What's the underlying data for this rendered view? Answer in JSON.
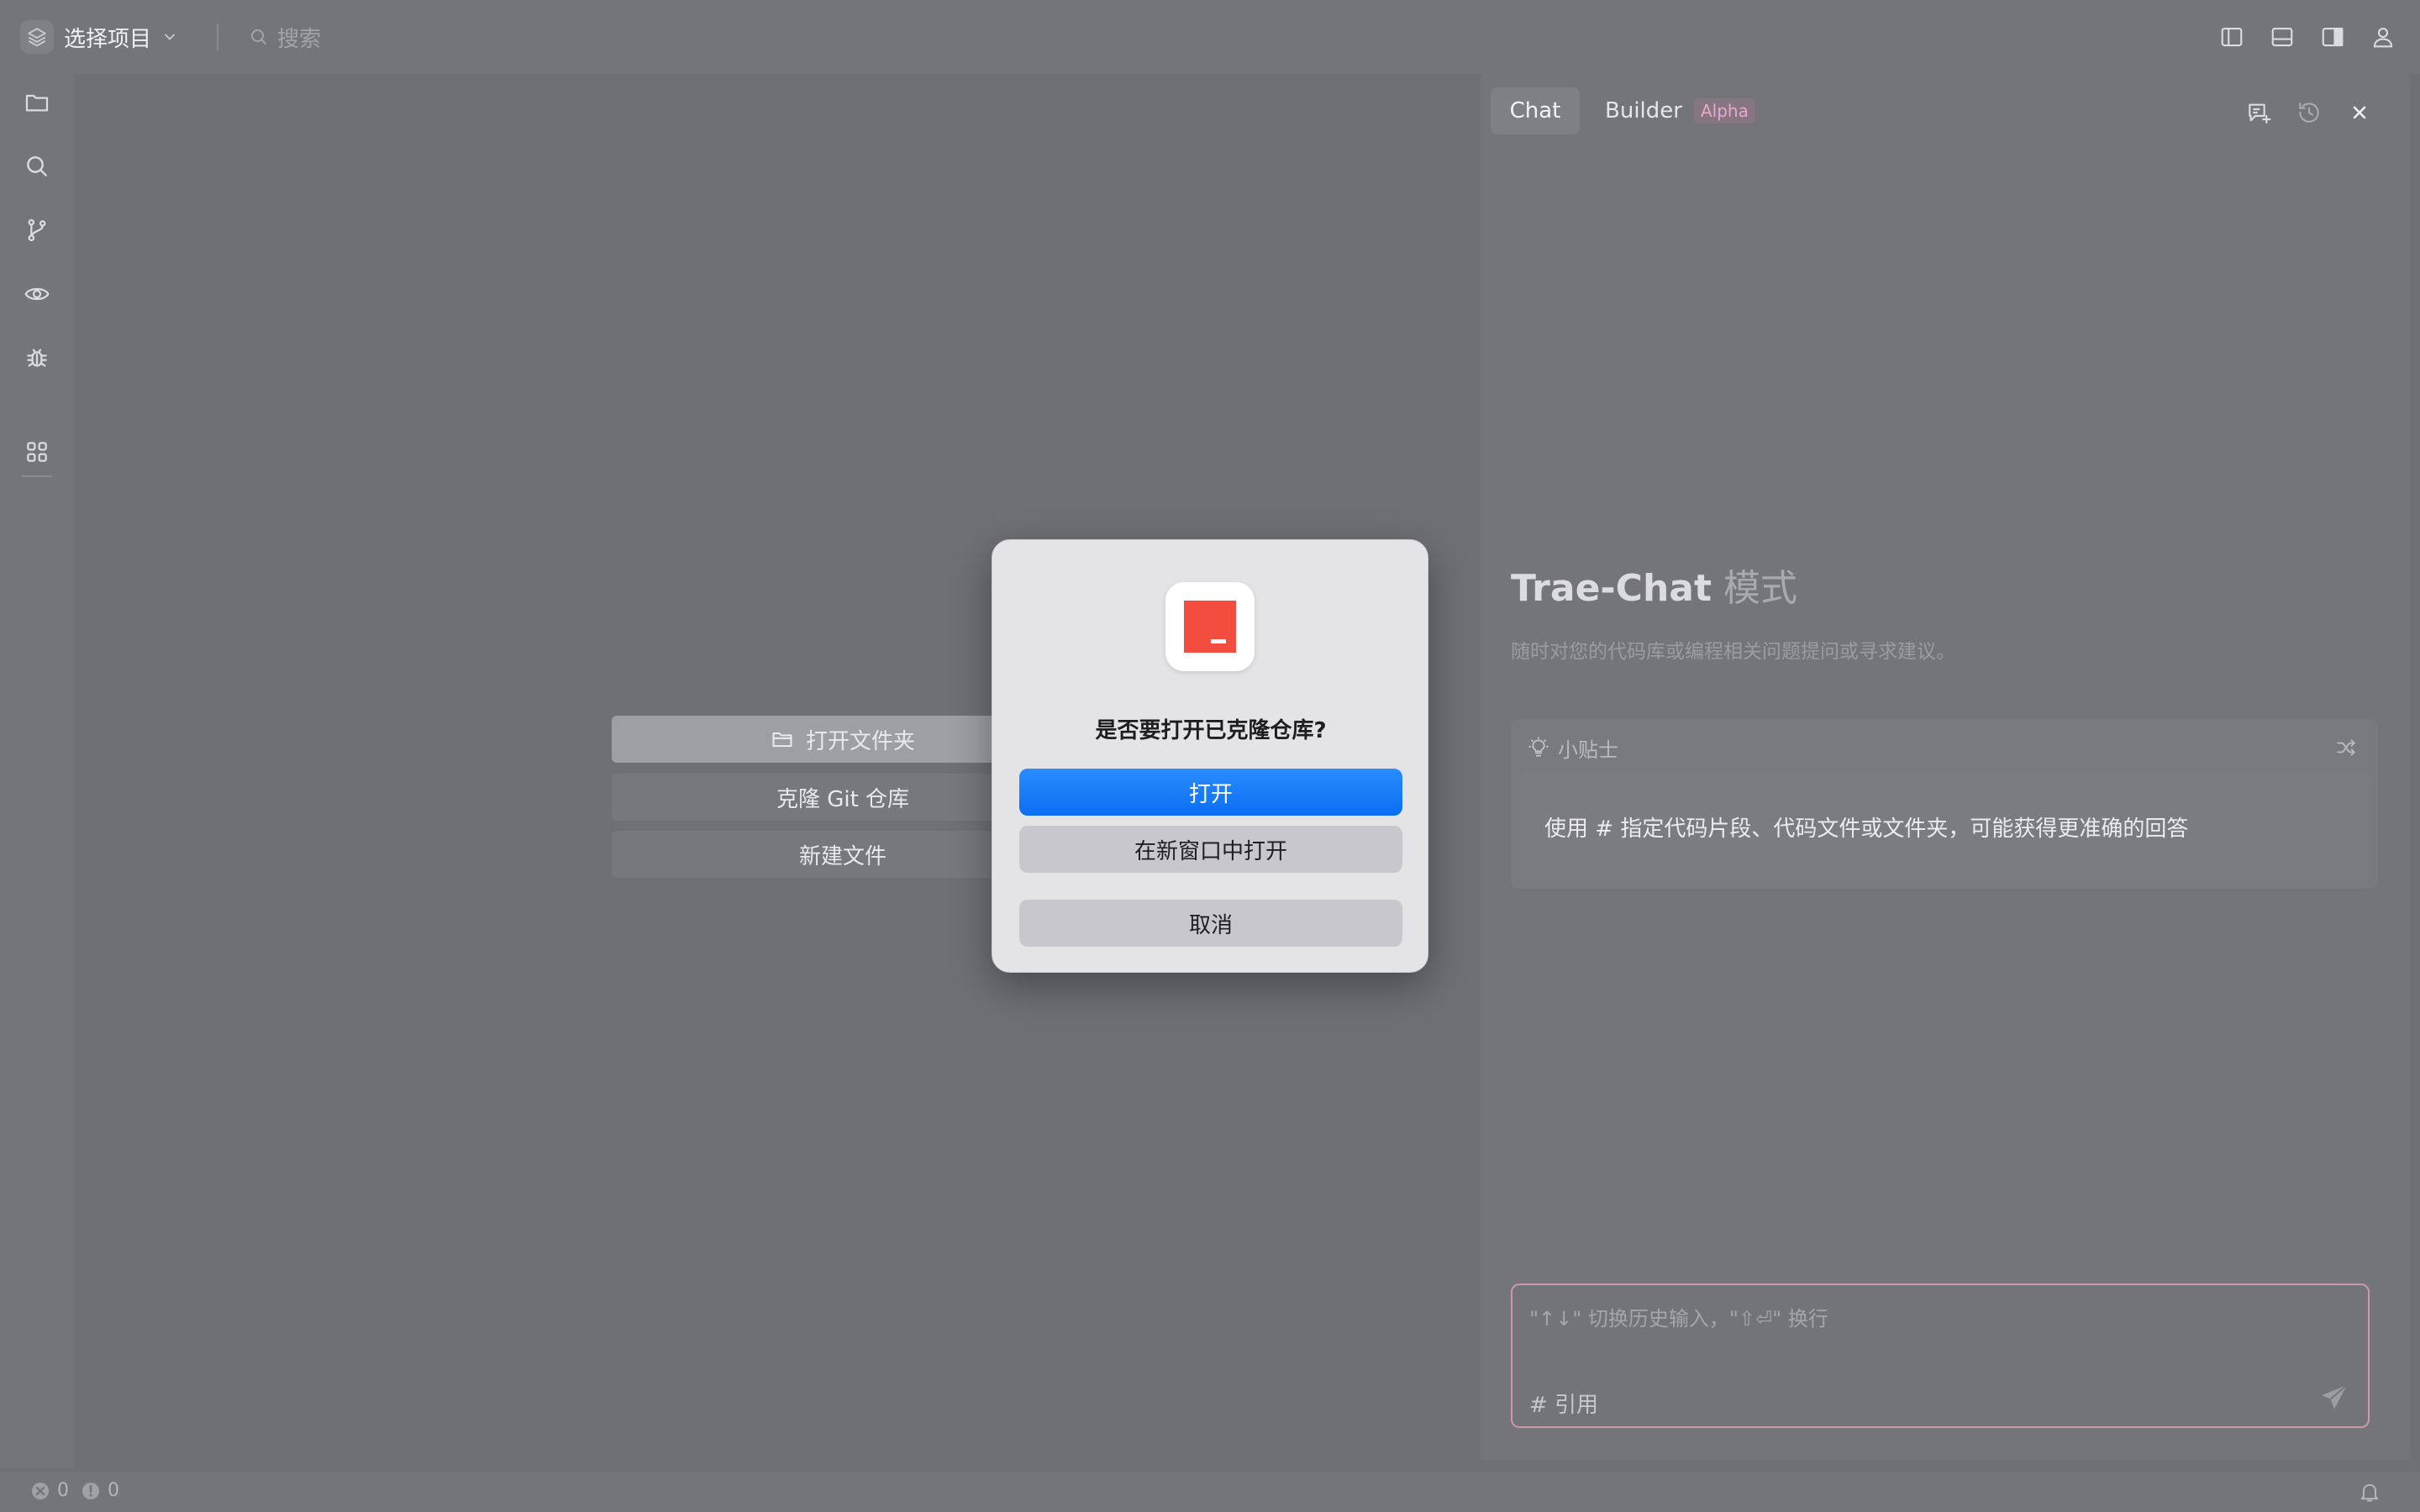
{
  "topbar": {
    "project_label": "选择项目",
    "search_placeholder": "搜索"
  },
  "icons": {
    "project": "layers-icon",
    "dropdown": "chevron-down-icon",
    "search": "search-icon",
    "toggle_sidebar": "sidebar-left-icon",
    "toggle_panel": "panel-bottom-icon",
    "toggle_aux": "sidebar-right-icon",
    "account": "user-icon",
    "explorer": "folder-icon",
    "search_view": "search-icon",
    "source_control": "git-branch-icon",
    "preview": "eye-icon",
    "debug": "bug-icon",
    "extensions": "grid-icon"
  },
  "welcome": {
    "open_folder": "打开文件夹",
    "clone_repo": "克隆 Git 仓库",
    "new_file": "新建文件"
  },
  "chat": {
    "tab_chat": "Chat",
    "tab_builder": "Builder",
    "builder_badge": "Alpha",
    "title_main": "Trae-Chat",
    "title_suffix": "模式",
    "subtitle": "随时对您的代码库或编程相关问题提问或寻求建议。",
    "tips_title": "小贴士",
    "tips_text": "使用 # 指定代码片段、代码文件或文件夹，可能获得更准确的回答",
    "input_placeholder": "\"↑↓\" 切换历史输入，\"⇧⏎\" 换行",
    "reference_label": "# 引用"
  },
  "statusbar": {
    "errors": "0",
    "warnings": "0"
  },
  "dialog": {
    "question": "是否要打开已克隆仓库?",
    "open": "打开",
    "open_new_window": "在新窗口中打开",
    "cancel": "取消"
  },
  "colors": {
    "accent_blue": "#0a6ef2",
    "app_red": "#f24d3f",
    "alpha_pink": "#e7a8d2",
    "input_border": "#c99aa8"
  }
}
